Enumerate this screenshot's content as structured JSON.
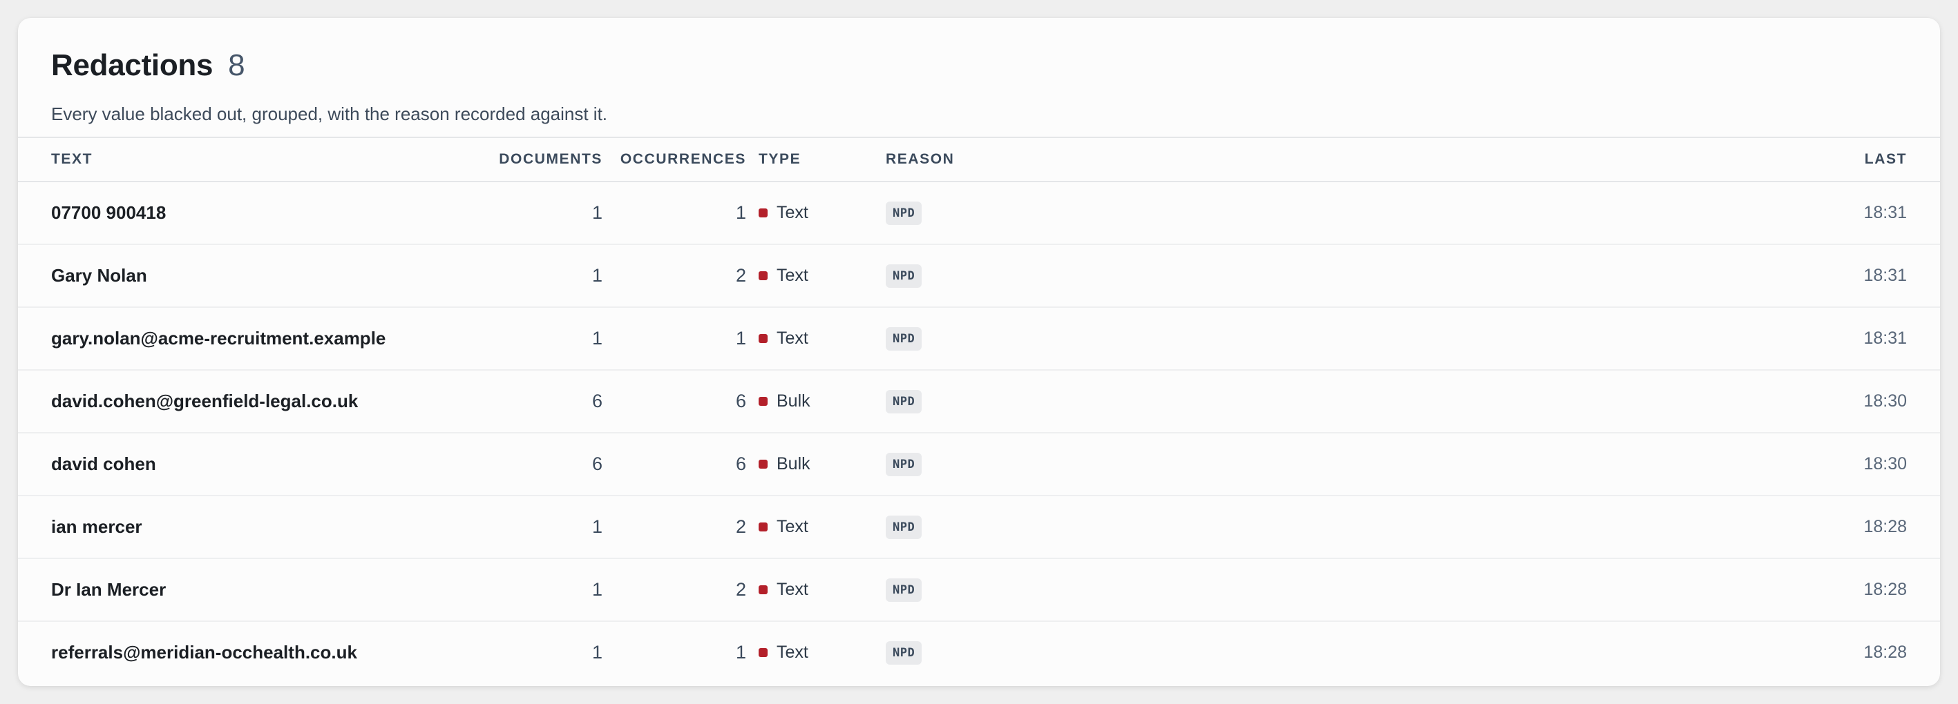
{
  "header": {
    "title": "Redactions",
    "count": "8",
    "subtitle": "Every value blacked out, grouped, with the reason recorded against it."
  },
  "columns": {
    "text": "TEXT",
    "documents": "DOCUMENTS",
    "occurrences": "OCCURRENCES",
    "type": "TYPE",
    "reason": "REASON",
    "last": "LAST"
  },
  "colors": {
    "type_dot": "#b3202a"
  },
  "rows": [
    {
      "text": "07700 900418",
      "documents": "1",
      "occurrences": "1",
      "type": "Text",
      "reason": "NPD",
      "last": "18:31"
    },
    {
      "text": "Gary Nolan",
      "documents": "1",
      "occurrences": "2",
      "type": "Text",
      "reason": "NPD",
      "last": "18:31"
    },
    {
      "text": "gary.nolan@acme-recruitment.example",
      "documents": "1",
      "occurrences": "1",
      "type": "Text",
      "reason": "NPD",
      "last": "18:31"
    },
    {
      "text": "david.cohen@greenfield-legal.co.uk",
      "documents": "6",
      "occurrences": "6",
      "type": "Bulk",
      "reason": "NPD",
      "last": "18:30"
    },
    {
      "text": "david cohen",
      "documents": "6",
      "occurrences": "6",
      "type": "Bulk",
      "reason": "NPD",
      "last": "18:30"
    },
    {
      "text": "ian mercer",
      "documents": "1",
      "occurrences": "2",
      "type": "Text",
      "reason": "NPD",
      "last": "18:28"
    },
    {
      "text": "Dr Ian Mercer",
      "documents": "1",
      "occurrences": "2",
      "type": "Text",
      "reason": "NPD",
      "last": "18:28"
    },
    {
      "text": "referrals@meridian-occhealth.co.uk",
      "documents": "1",
      "occurrences": "1",
      "type": "Text",
      "reason": "NPD",
      "last": "18:28"
    }
  ]
}
